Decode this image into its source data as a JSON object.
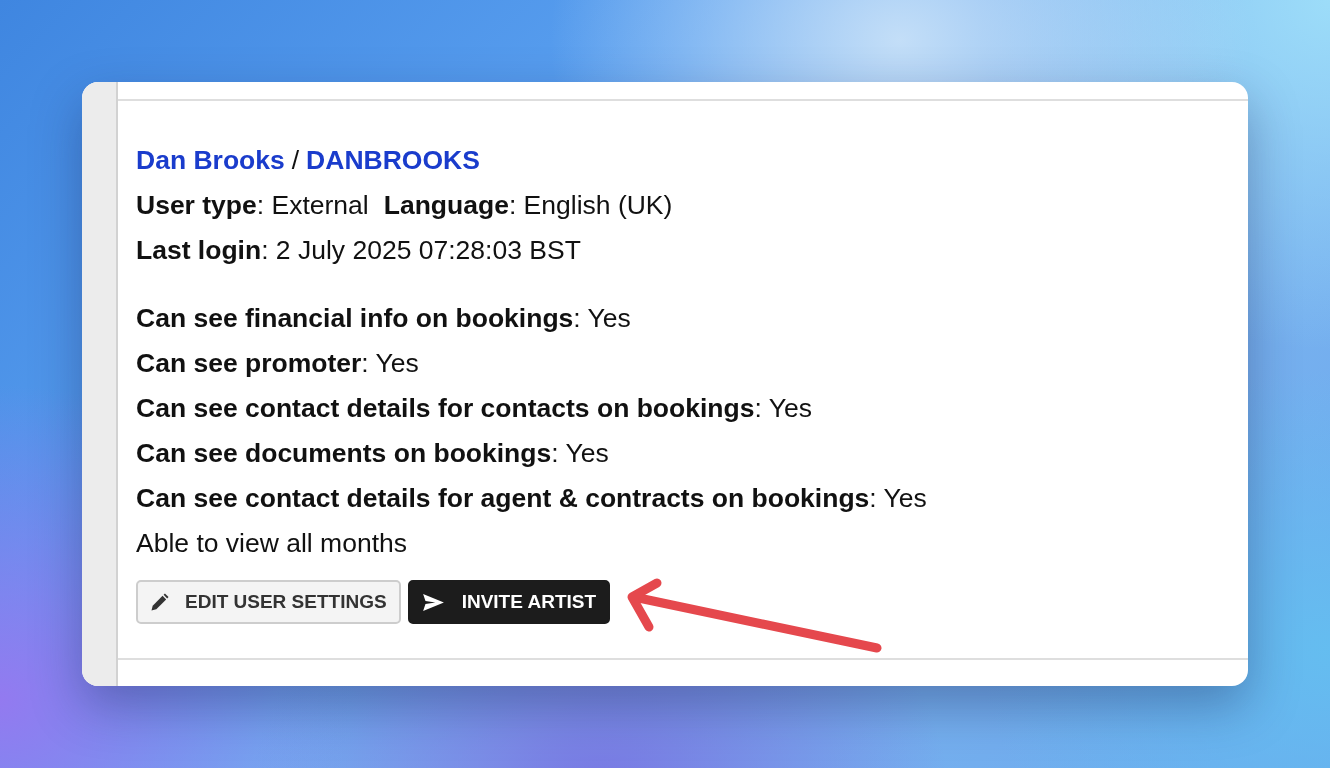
{
  "user": {
    "name": "Dan Brooks",
    "separator": "/",
    "username": "DANBROOKS"
  },
  "details": [
    {
      "text": "**User type**: External"
    },
    {
      "text": "**Language**: English (UK)"
    }
  ],
  "last_login": "**Last login**: 2 July 2025 07:28:03 BST",
  "permissions": [
    "**Can see financial info on bookings**: Yes",
    "**Can see promoter**: Yes",
    "**Can see contact details for contacts on bookings**: Yes",
    "**Can see documents on bookings**: Yes",
    "**Can see contact details for agent & contracts on bookings**: Yes"
  ],
  "note": "Able to view all months",
  "buttons": [
    {
      "label": "EDIT USER SETTINGS",
      "kind": "outline"
    },
    {
      "label": "INVITE ARTIST",
      "kind": "dark"
    }
  ]
}
